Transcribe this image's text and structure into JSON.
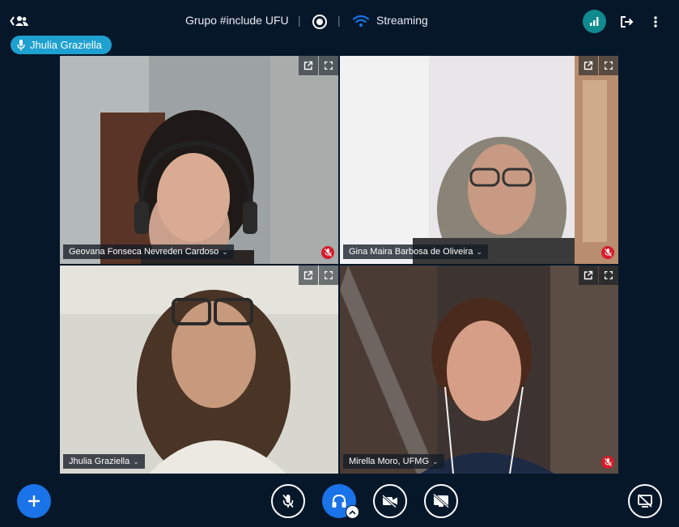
{
  "header": {
    "meeting_title": "Grupo #include UFU",
    "separator": "|",
    "streaming_label": "Streaming"
  },
  "talking_indicator": {
    "name": "Jhulia Graziella"
  },
  "tiles": [
    {
      "name": "Geovana Fonseca Nevreden Cardoso",
      "muted": true,
      "active": false
    },
    {
      "name": "Gina Maira Barbosa de Oliveira",
      "muted": true,
      "active": false
    },
    {
      "name": "Jhulia Graziella",
      "muted": false,
      "active": true
    },
    {
      "name": "Mirella Moro, UFMG",
      "muted": true,
      "active": false
    }
  ],
  "caret": "⌄",
  "colors": {
    "background": "#06172a",
    "accent_blue": "#1a73e8",
    "talking_badge": "#1ea0d0",
    "stats_teal": "#0f8a8f",
    "muted_red": "#d81b2a",
    "active_border": "#2c7fd9"
  },
  "icons": {
    "users_toggle": "users-icon",
    "record": "record-icon",
    "streaming": "wifi-icon",
    "connection": "signal-bars-icon",
    "leave": "logout-icon",
    "more": "more-vertical-icon",
    "talking_mic": "microphone-icon",
    "tile_popout": "external-link-icon",
    "tile_fullscreen": "fullscreen-icon",
    "actions": "plus-icon",
    "mute": "microphone-off-icon",
    "audio": "headphones-icon",
    "video": "video-off-icon",
    "screenshare": "screenshare-off-icon",
    "presentation": "presentation-off-icon"
  }
}
